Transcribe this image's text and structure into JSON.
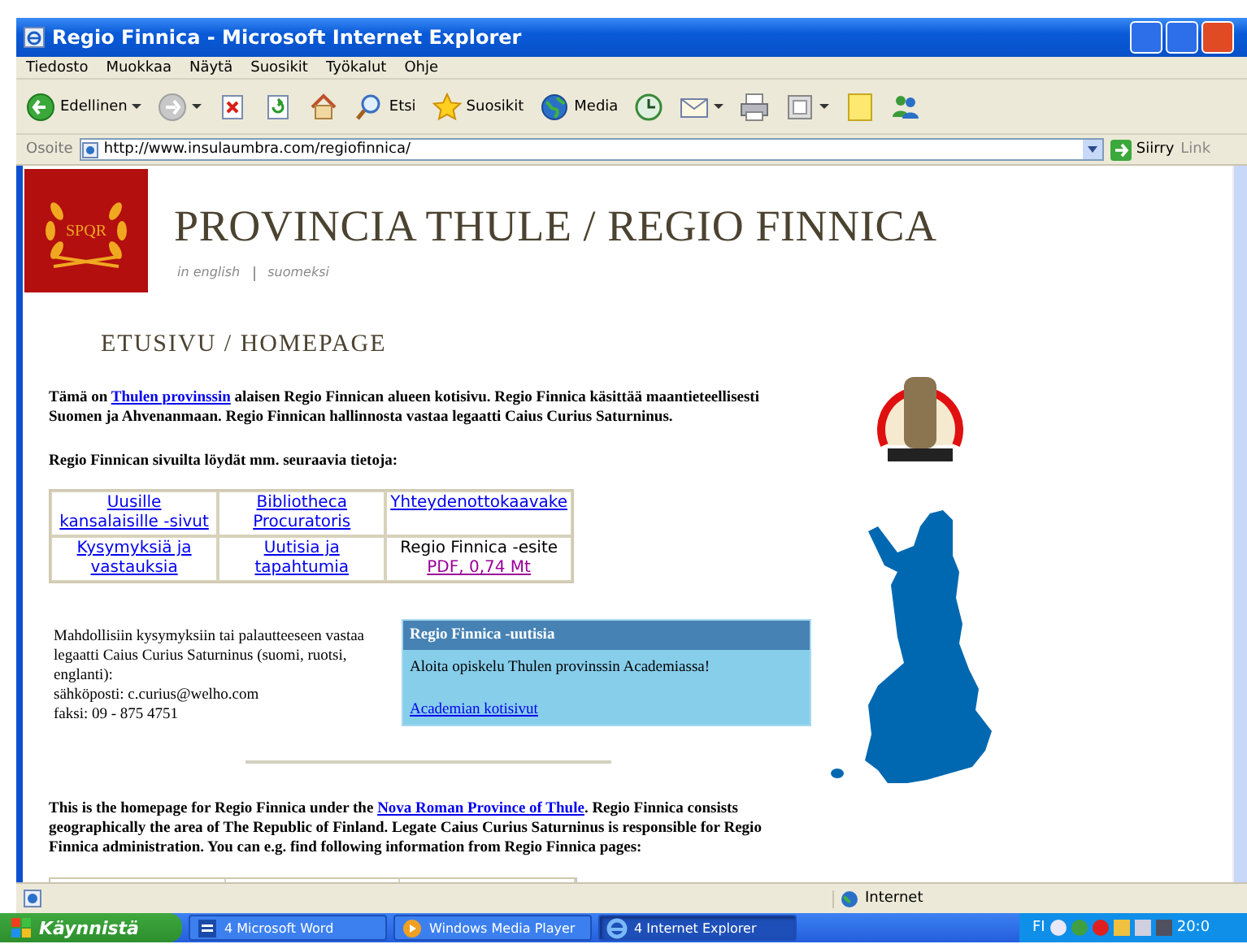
{
  "window": {
    "title": "Regio Finnica - Microsoft Internet Explorer"
  },
  "menu": [
    "Tiedosto",
    "Muokkaa",
    "Näytä",
    "Suosikit",
    "Työkalut",
    "Ohje"
  ],
  "toolbar": [
    {
      "kind": "back",
      "label": "Edellinen",
      "caret": true
    },
    {
      "kind": "forward",
      "caret": true
    },
    {
      "kind": "stop",
      "caret": false
    },
    {
      "kind": "refresh",
      "caret": false
    },
    {
      "kind": "home",
      "caret": false
    },
    {
      "kind": "search",
      "label": "Etsi",
      "caret": false
    },
    {
      "kind": "favorites",
      "label": "Suosikit",
      "caret": false
    },
    {
      "kind": "media",
      "label": "Media",
      "caret": false
    },
    {
      "kind": "history",
      "caret": false
    },
    {
      "kind": "mail",
      "caret": true
    },
    {
      "kind": "print",
      "caret": false
    },
    {
      "kind": "edit",
      "caret": true
    },
    {
      "kind": "note",
      "caret": false
    },
    {
      "kind": "messenger",
      "caret": false
    }
  ],
  "address": {
    "label": "Osoite",
    "value": "http://www.insulaumbra.com/regiofinnica/",
    "go": "Siirry",
    "links": "Link"
  },
  "page": {
    "logo": "SPQR",
    "title": "PROVINCIA THULE / REGIO FINNICA",
    "languages": [
      "in english",
      "suomeksi"
    ],
    "heading": "ETUSIVU / HOMEPAGE",
    "intro": {
      "before": "Tämä on ",
      "link": "Thulen provinssin",
      "after": " alaisen Regio Finnican alueen kotisivu. Regio Finnica käsittää maantieteellisesti Suomen ja Ahvenanmaan. Regio Finnican hallinnosta vastaa legaatti Caius Curius Saturninus."
    },
    "intro2": "Regio Finnican sivuilta löydät mm. seuraavia tietoja:",
    "links_table": [
      [
        {
          "kind": "link",
          "text": "Uusille kansalaisille -sivut",
          "visited": false
        },
        {
          "kind": "link",
          "text": "Bibliotheca Procuratoris",
          "visited": false
        },
        {
          "kind": "link",
          "text": "Yhteydenottokaavake",
          "visited": false
        }
      ],
      [
        {
          "kind": "link",
          "text": "Kysymyksiä ja vastauksia",
          "visited": false
        },
        {
          "kind": "link",
          "text": "Uutisia ja tapahtumia",
          "visited": false
        },
        {
          "kind": "file",
          "text": "Regio Finnica -esite",
          "link": "PDF, 0,74 Mt",
          "visited": true
        }
      ]
    ],
    "contact": [
      "Mahdollisiin kysymyksiin tai palautteeseen vastaa legaatti Caius Curius Saturninus (suomi, ruotsi, englanti):",
      "sähköposti: c.curius@welho.com",
      "faksi: 09 - 875 4751"
    ],
    "news": {
      "title": "Regio Finnica -uutisia",
      "text": "Aloita opiskelu Thulen provinssin Academiassa!",
      "link": "Academian kotisivut"
    },
    "english": {
      "before": "This is the homepage for Regio Finnica under the ",
      "link": "Nova Roman Province of Thule",
      "after": ". Regio Finnica consists geographically the area of The Republic of Finland. Legate Caius Curius Saturninus is responsible for Regio Finnica administration. You can e.g. find following information from Regio Finnica pages:"
    }
  },
  "status_bar": {
    "zone": "Internet"
  },
  "taskbar": {
    "start": "Käynnistä",
    "tasks": [
      {
        "kind": "word",
        "label": "4 Microsoft Word",
        "selected": false
      },
      {
        "kind": "media",
        "label": "Windows Media Player",
        "selected": false
      },
      {
        "kind": "ie",
        "label": "4 Internet Explorer",
        "selected": true
      }
    ],
    "language": "FI",
    "clock": "20:0"
  }
}
